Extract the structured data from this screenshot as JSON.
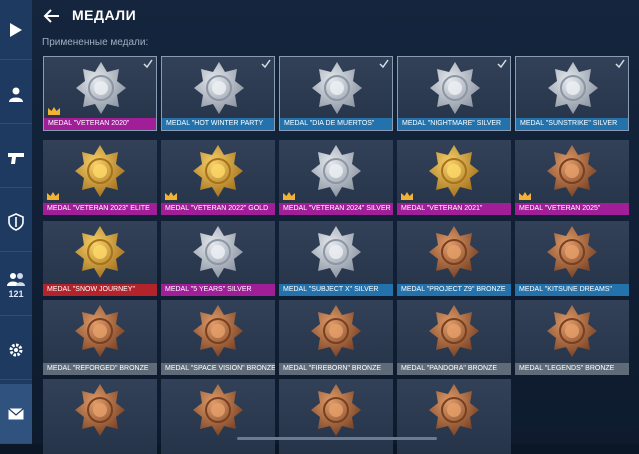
{
  "header": {
    "title": "МЕДАЛИ"
  },
  "section": {
    "applied_label": "Примененные медали:"
  },
  "rail": {
    "friends_count": "121"
  },
  "colors": {
    "purple": "#a01f98",
    "blue": "#2372ac",
    "red": "#b3232c",
    "gray": "#5f6b78",
    "silver": "#c9ced6",
    "gold": "#d9a52b",
    "bronze": "#b4713a"
  },
  "medals": [
    {
      "label": "MEDAL \"VETERAN 2020\"",
      "bar": "purple",
      "applied": true,
      "elite": true,
      "metal": "silver"
    },
    {
      "label": "MEDAL \"HOT WINTER PARTY",
      "bar": "blue",
      "applied": true,
      "elite": false,
      "metal": "silver"
    },
    {
      "label": "MEDAL \"DIA DE MUERTOS\"",
      "bar": "blue",
      "applied": true,
      "elite": false,
      "metal": "silver"
    },
    {
      "label": "MEDAL \"NIGHTMARE\" SILVER",
      "bar": "blue",
      "applied": true,
      "elite": false,
      "metal": "silver"
    },
    {
      "label": "MEDAL \"SUNSTRIKE\" SILVER",
      "bar": "blue",
      "applied": true,
      "elite": false,
      "metal": "silver"
    },
    {
      "label": "MEDAL \"VETERAN 2023\" ELITE",
      "bar": "purple",
      "applied": false,
      "elite": true,
      "metal": "gold"
    },
    {
      "label": "MEDAL \"VETERAN 2022\" GOLD",
      "bar": "purple",
      "applied": false,
      "elite": true,
      "metal": "gold"
    },
    {
      "label": "MEDAL \"VETERAN 2024\" SILVER",
      "bar": "purple",
      "applied": false,
      "elite": true,
      "metal": "silver"
    },
    {
      "label": "MEDAL \"VETERAN 2021\"",
      "bar": "purple",
      "applied": false,
      "elite": true,
      "metal": "gold"
    },
    {
      "label": "MEDAL \"VETERAN 2025\"",
      "bar": "purple",
      "applied": false,
      "elite": true,
      "metal": "bronze"
    },
    {
      "label": "MEDAL \"SNOW JOURNEY\"",
      "bar": "red",
      "applied": false,
      "elite": false,
      "metal": "gold"
    },
    {
      "label": "MEDAL \"5 YEARS\" SILVER",
      "bar": "purple",
      "applied": false,
      "elite": false,
      "metal": "silver"
    },
    {
      "label": "MEDAL \"SUBJECT X\" SILVER",
      "bar": "blue",
      "applied": false,
      "elite": false,
      "metal": "silver"
    },
    {
      "label": "MEDAL \"PROJECT Z9\" BRONZE",
      "bar": "blue",
      "applied": false,
      "elite": false,
      "metal": "bronze"
    },
    {
      "label": "MEDAL \"KITSUNE DREAMS\"",
      "bar": "blue",
      "applied": false,
      "elite": false,
      "metal": "bronze"
    },
    {
      "label": "MEDAL \"REFORGED\" BRONZE",
      "bar": "gray",
      "applied": false,
      "elite": false,
      "metal": "bronze"
    },
    {
      "label": "MEDAL \"SPACE VISION\" BRONZE",
      "bar": "gray",
      "applied": false,
      "elite": false,
      "metal": "bronze"
    },
    {
      "label": "MEDAL \"FIREBORN\" BRONZE",
      "bar": "gray",
      "applied": false,
      "elite": false,
      "metal": "bronze"
    },
    {
      "label": "MEDAL \"PANDORA\" BRONZE",
      "bar": "gray",
      "applied": false,
      "elite": false,
      "metal": "bronze"
    },
    {
      "label": "MEDAL \"LEGENDS\" BRONZE",
      "bar": "gray",
      "applied": false,
      "elite": false,
      "metal": "bronze"
    },
    {
      "label": "",
      "bar": "gray",
      "applied": false,
      "elite": false,
      "metal": "bronze"
    },
    {
      "label": "",
      "bar": "gray",
      "applied": false,
      "elite": false,
      "metal": "bronze"
    },
    {
      "label": "",
      "bar": "gray",
      "applied": false,
      "elite": false,
      "metal": "bronze"
    },
    {
      "label": "",
      "bar": "gray",
      "applied": false,
      "elite": false,
      "metal": "bronze"
    }
  ]
}
